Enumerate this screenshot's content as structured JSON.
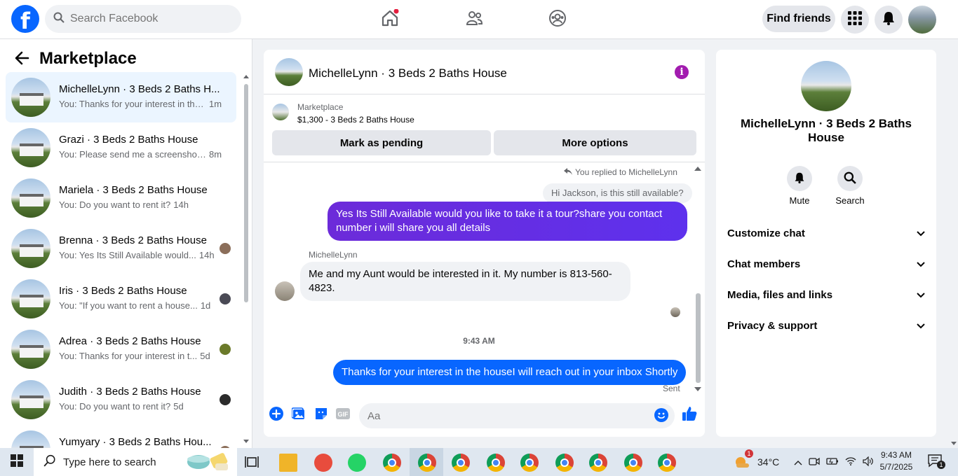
{
  "header": {
    "logo": "f",
    "search_placeholder": "Search Facebook",
    "find_friends": "Find friends"
  },
  "sidebar": {
    "title": "Marketplace",
    "conversations": [
      {
        "title": "MichelleLynn · 3 Beds 2 Baths H...",
        "preview": "You: Thanks for your interest in the...",
        "time": "1m"
      },
      {
        "title": "Grazi · 3 Beds 2 Baths House",
        "preview": "You: Please send me a screenshot ...",
        "time": "8m"
      },
      {
        "title": "Mariela · 3 Beds 2 Baths House",
        "preview": "You: Do you want to rent it?",
        "time": "14h"
      },
      {
        "title": "Brenna · 3 Beds 2 Baths House",
        "preview": "You: Yes Its Still Available would...",
        "time": "14h"
      },
      {
        "title": "Iris · 3 Beds 2 Baths House",
        "preview": "You: \"If you want to rent a house...",
        "time": "1d"
      },
      {
        "title": "Adrea · 3 Beds 2 Baths House",
        "preview": "You: Thanks for your interest in t...",
        "time": "5d"
      },
      {
        "title": "Judith · 3 Beds 2 Baths House",
        "preview": "You: Do you want to rent it?",
        "time": "5d"
      },
      {
        "title": "Yumyary · 3 Beds 2 Baths Hou...",
        "preview": "",
        "time": ""
      }
    ]
  },
  "chat": {
    "title": "MichelleLynn · 3 Beds 2 Baths House",
    "listing_source": "Marketplace",
    "listing_desc": "$1,300 - 3 Beds 2 Baths House",
    "mark_pending": "Mark as pending",
    "more_options": "More options",
    "reply_note": "You replied to MichelleLynn",
    "quoted": "Hi Jackson, is this still available?",
    "msg1": "Yes Its Still Available would you like to take it a tour?share you contact number i will share you all details",
    "sender": "MichelleLynn",
    "msg2": "Me and my Aunt would be interested in it.  My number is 813-560-4823.",
    "timestamp": "9:43 AM",
    "msg3": "Thanks for your interest in the houseI will reach out in your inbox Shortly",
    "status": "Sent",
    "input_placeholder": "Aa"
  },
  "details": {
    "name": "MichelleLynn · 3 Beds 2 Baths House",
    "mute": "Mute",
    "search": "Search",
    "sections": [
      "Customize chat",
      "Chat members",
      "Media, files and links",
      "Privacy & support"
    ]
  },
  "taskbar": {
    "search_placeholder": "Type here to search",
    "temperature": "34°C",
    "weather_badge": "1",
    "time": "9:43 AM",
    "date": "5/7/2025",
    "notification_count": "1"
  },
  "colors": {
    "brand": "#0866ff",
    "purple_bubble": "#6c2bd9",
    "blue_bubble": "#0866ff",
    "info": "#a21caf"
  }
}
